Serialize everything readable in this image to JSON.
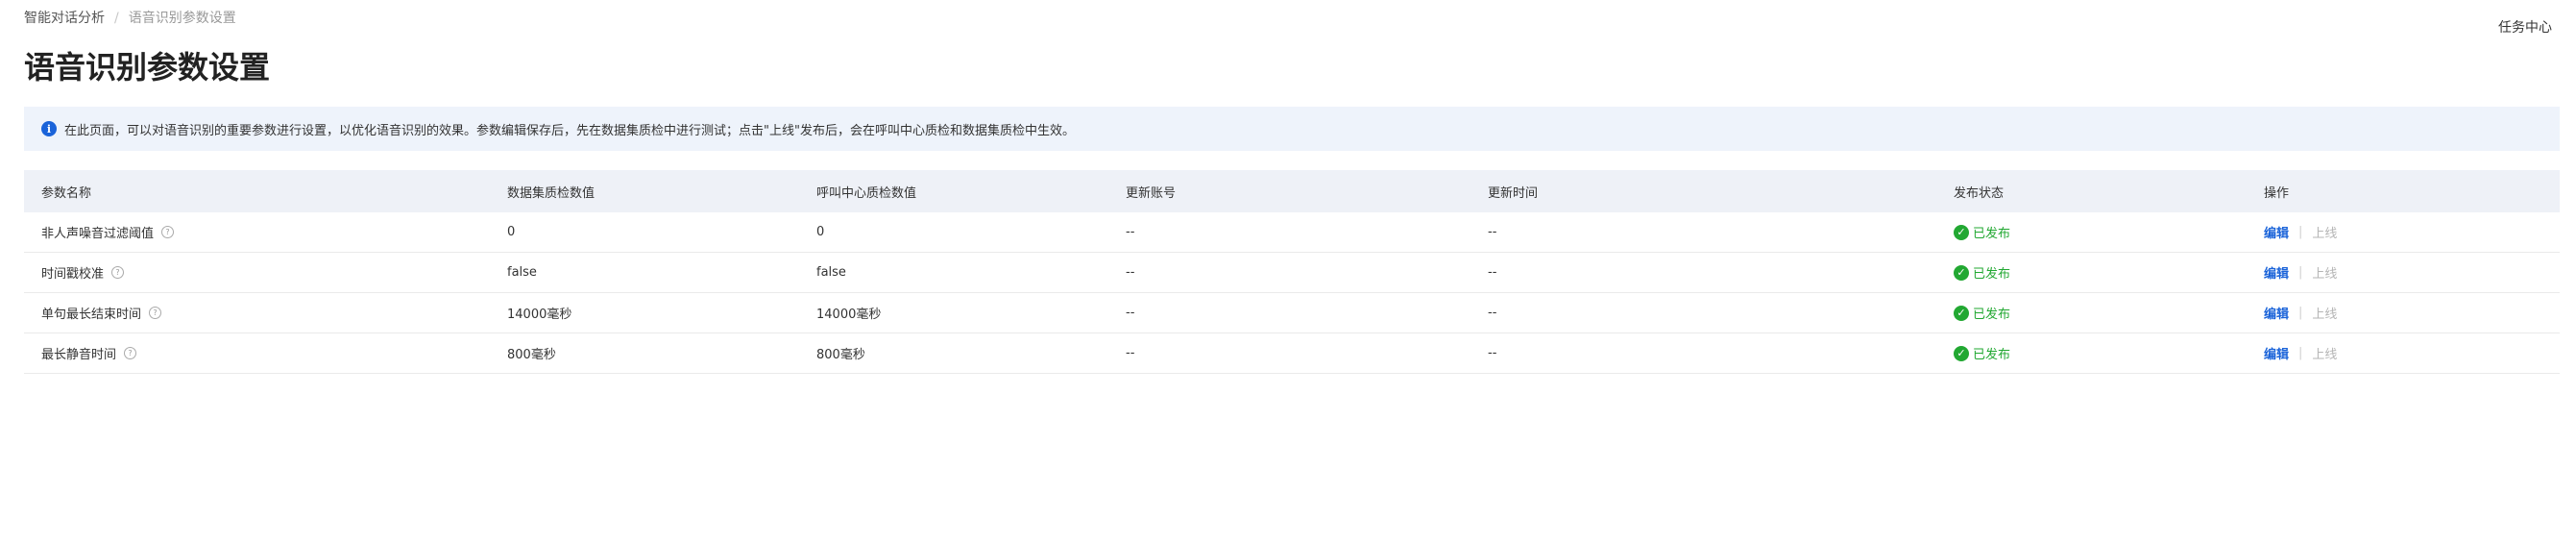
{
  "breadcrumb": {
    "parent": "智能对话分析",
    "separator": "/",
    "current": "语音识别参数设置"
  },
  "header": {
    "task_center": "任务中心",
    "title": "语音识别参数设置"
  },
  "info_banner": {
    "icon": "info-icon",
    "text": "在此页面，可以对语音识别的重要参数进行设置，以优化语音识别的效果。参数编辑保存后，先在数据集质检中进行测试；点击\"上线\"发布后，会在呼叫中心质检和数据集质检中生效。"
  },
  "table": {
    "columns": [
      "参数名称",
      "数据集质检数值",
      "呼叫中心质检数值",
      "更新账号",
      "更新时间",
      "发布状态",
      "操作"
    ],
    "rows": [
      {
        "name": "非人声噪音过滤阈值",
        "dataset_value": "0",
        "callcenter_value": "0",
        "account": "--",
        "time": "--",
        "status": "已发布",
        "edit": "编辑",
        "publish": "上线"
      },
      {
        "name": "时间戳校准",
        "dataset_value": "false",
        "callcenter_value": "false",
        "account": "--",
        "time": "--",
        "status": "已发布",
        "edit": "编辑",
        "publish": "上线"
      },
      {
        "name": "单句最长结束时间",
        "dataset_value": "14000毫秒",
        "callcenter_value": "14000毫秒",
        "account": "--",
        "time": "--",
        "status": "已发布",
        "edit": "编辑",
        "publish": "上线"
      },
      {
        "name": "最长静音时间",
        "dataset_value": "800毫秒",
        "callcenter_value": "800毫秒",
        "account": "--",
        "time": "--",
        "status": "已发布",
        "edit": "编辑",
        "publish": "上线"
      }
    ]
  },
  "icons": {
    "help": "question-circle-icon",
    "status": "check-circle-icon"
  },
  "colors": {
    "accent": "#1a63d9",
    "success": "#22a832",
    "banner_bg": "#eef3fb",
    "header_bg": "#eef1f7",
    "disabled": "#b5b5b5"
  }
}
